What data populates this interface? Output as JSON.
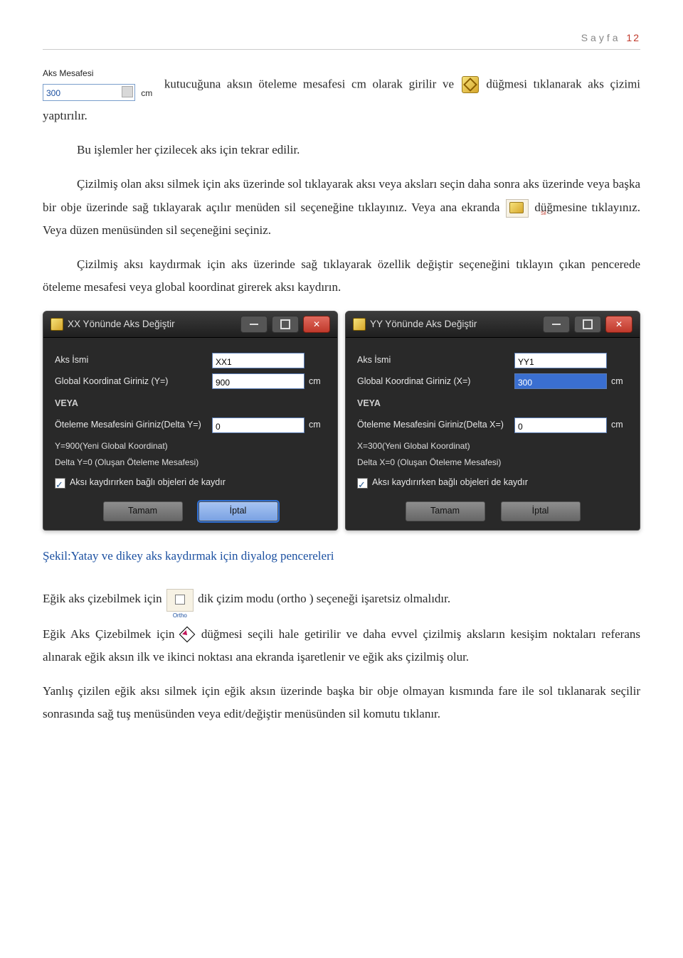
{
  "page_header": {
    "label": "Sayfa",
    "number": "12"
  },
  "aks_widget": {
    "label": "Aks Mesafesi",
    "value": "300",
    "unit": "cm"
  },
  "para1a": " kutucuğuna aksın öteleme mesafesi cm olarak girilir ve ",
  "para1b": " düğmesi tıklanarak aks çizimi yaptırılır.",
  "para2": "Bu işlemler her çizilecek aks için tekrar edilir.",
  "para3a": "Çizilmiş olan aksı silmek için aks üzerinde sol tıklayarak aksı veya aksları seçin daha sonra aks üzerinde veya başka bir obje üzerinde sağ tıklayarak açılır menüden sil seçeneğine tıklayınız. Veya ana ekranda ",
  "para3b": " düğmesine tıklayınız. Veya düzen menüsünden sil seçeneğini seçiniz.",
  "para4": "Çizilmiş aksı kaydırmak için aks üzerinde sağ tıklayarak özellik değiştir seçeneğini tıklayın çıkan pencerede öteleme mesafesi veya global koordinat girerek aksı kaydırın.",
  "dialogs": {
    "x": {
      "title": "XX Yönünde Aks  Değiştir",
      "name_label": "Aks İsmi",
      "name_value": "XX1",
      "global_label": "Global Koordinat Giriniz (Y=)",
      "global_value": "900",
      "veya": "VEYA",
      "delta_label": "Öteleme Mesafesini Giriniz(Delta Y=)",
      "delta_value": "0",
      "info1": "Y=900(Yeni Global Koordinat)",
      "info2": "Delta Y=0 (Oluşan Öteleme Mesafesi)",
      "checkbox": "Aksı kaydırırken bağlı objeleri de kaydır",
      "ok": "Tamam",
      "cancel": "İptal",
      "unit": "cm"
    },
    "y": {
      "title": "YY Yönünde Aks  Değiştir",
      "name_label": "Aks İsmi",
      "name_value": "YY1",
      "global_label": "Global Koordinat Giriniz (X=)",
      "global_value": "300",
      "veya": "VEYA",
      "delta_label": "Öteleme Mesafesini Giriniz(Delta X=)",
      "delta_value": "0",
      "info1": "X=300(Yeni Global Koordinat)",
      "info2": "Delta X=0 (Oluşan Öteleme Mesafesi)",
      "checkbox": "Aksı kaydırırken bağlı objeleri de kaydır",
      "ok": "Tamam",
      "cancel": "İptal",
      "unit": "cm"
    }
  },
  "figure_caption": "Şekil:Yatay ve dikey aks kaydırmak için diyalog pencereleri",
  "para5a": "Eğik aks çizebilmek için ",
  "para5b": " dik çizim modu (ortho ) seçeneği işaretsiz olmalıdır.",
  "ortho_label": "Ortho",
  "para6a": "Eğik Aks Çizebilmek için ",
  "para6b": " düğmesi seçili hale getirilir ve daha evvel çizilmiş aksların kesişim noktaları referans alınarak eğik aksın ilk ve ikinci noktası ana ekranda işaretlenir ve eğik aks çizilmiş olur.",
  "para7": "Yanlış çizilen eğik aksı silmek için eğik aksın üzerinde başka bir obje olmayan kısmında fare ile sol tıklanarak seçilir sonrasında sağ tuş menüsünden veya edit/değiştir menüsünden sil komutu tıklanır.",
  "sil_icon_label": "Sil"
}
